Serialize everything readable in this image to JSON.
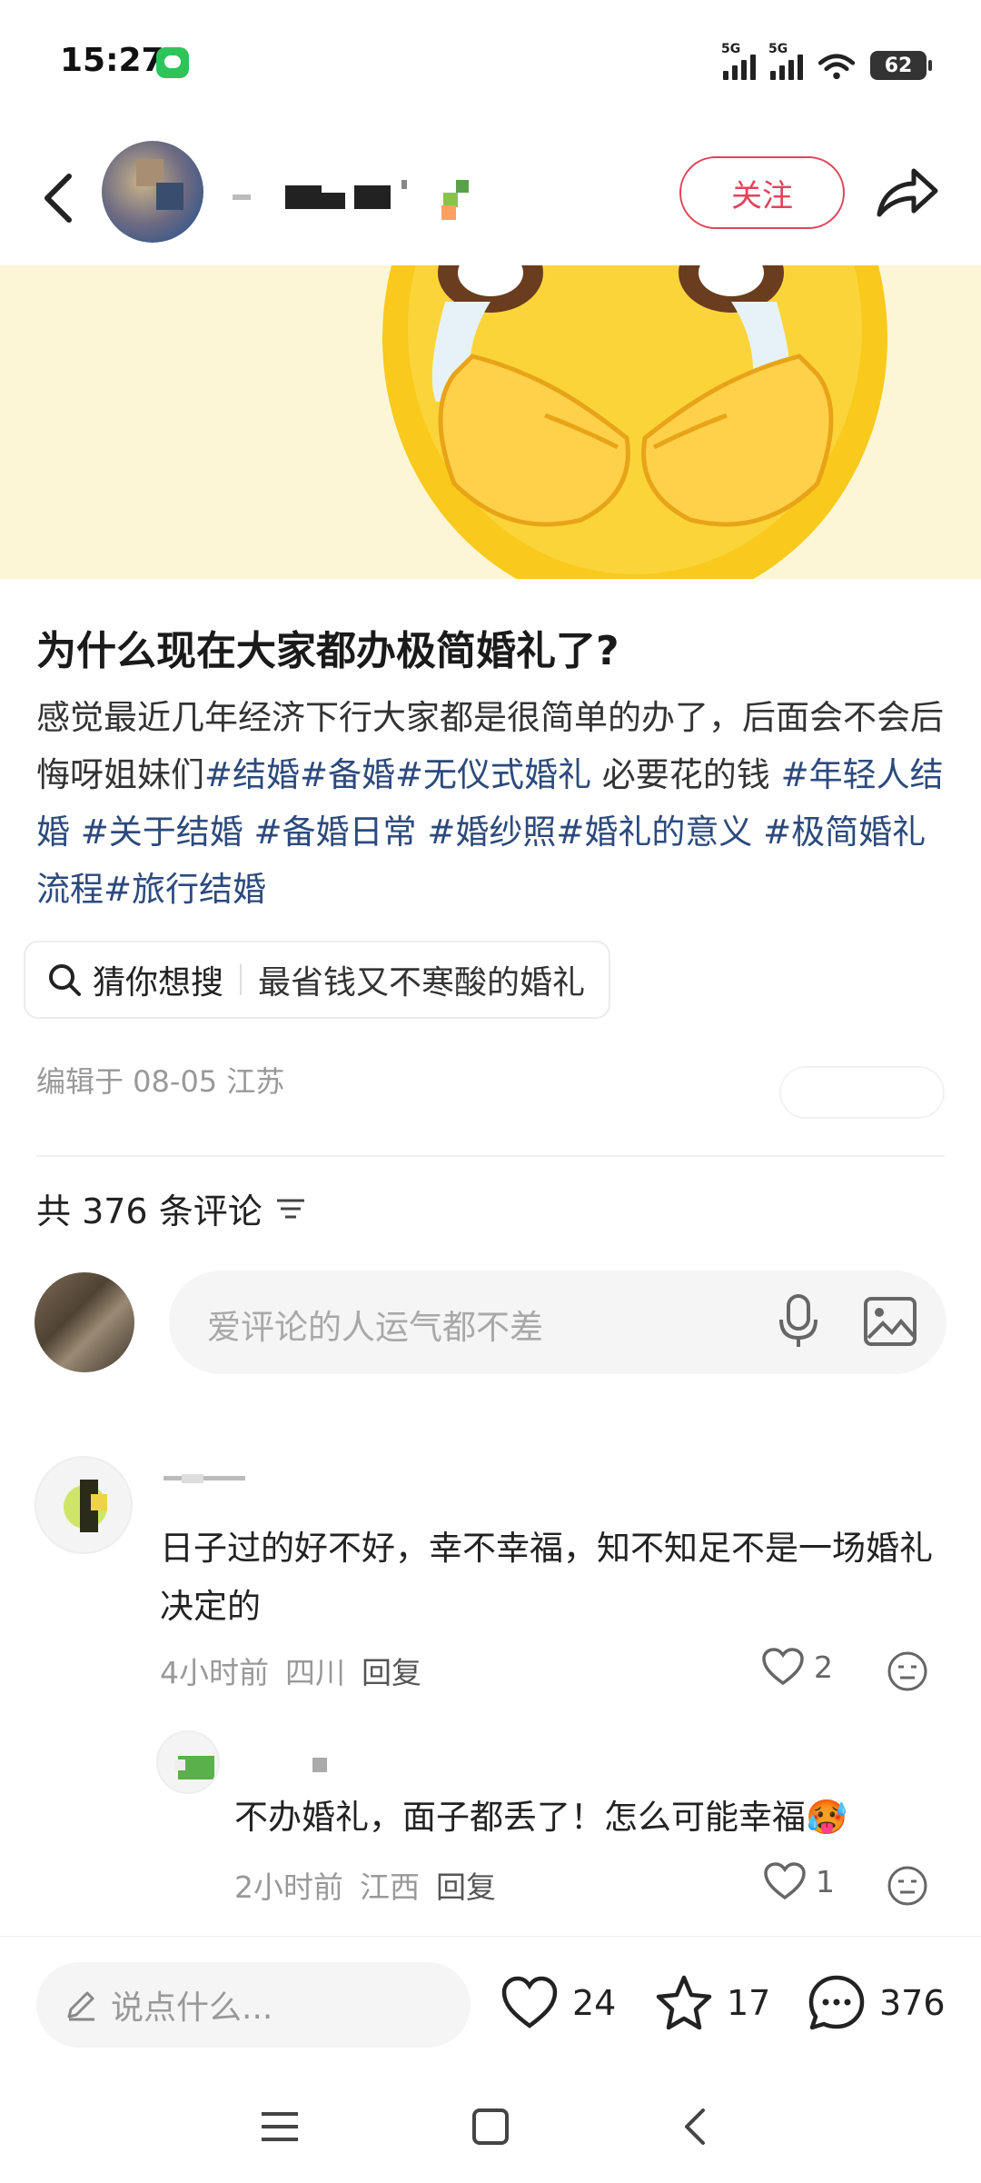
{
  "status_bar": {
    "time": "15:27",
    "signal1": "5G",
    "signal2": "5G",
    "battery": "62"
  },
  "nav": {
    "follow_label": "关注"
  },
  "post": {
    "title": "为什么现在大家都办极简婚礼了?",
    "body_plain": "感觉最近几年经济下行大家都是很简单的办了，后面会不会后悔呀姐妹们",
    "tags": [
      "#结婚",
      "#备婚",
      "#无仪式婚礼"
    ],
    "body_mid": " 必要花的钱 ",
    "tags2": [
      "#年轻人结婚",
      "#关于结婚",
      "#备婚日常",
      "#婚纱照",
      "#婚礼的意义",
      "#极简婚礼流程",
      "#旅行结婚"
    ],
    "meta": "编辑于 08-05 江苏"
  },
  "suggest": {
    "label": "猜你想搜",
    "query": "最省钱又不寒酸的婚礼"
  },
  "comments_header": {
    "count_label": "共 376 条评论"
  },
  "comment_input": {
    "placeholder": "爱评论的人运气都不差"
  },
  "comments": [
    {
      "text": "日子过的好不好，幸不幸福，知不知足不是一场婚礼决定的",
      "time": "4小时前",
      "location": "四川",
      "reply_label": "回复",
      "likes": "2"
    },
    {
      "text": "不办婚礼，面子都丢了！怎么可能幸福🥵",
      "time": "2小时前",
      "location": "江西",
      "reply_label": "回复",
      "likes": "1"
    }
  ],
  "bottom_bar": {
    "input_placeholder": "说点什么...",
    "likes": "24",
    "favorites": "17",
    "comments": "376"
  },
  "colors": {
    "accent_red": "#e0455a",
    "tag_blue": "#2c4a7d"
  }
}
